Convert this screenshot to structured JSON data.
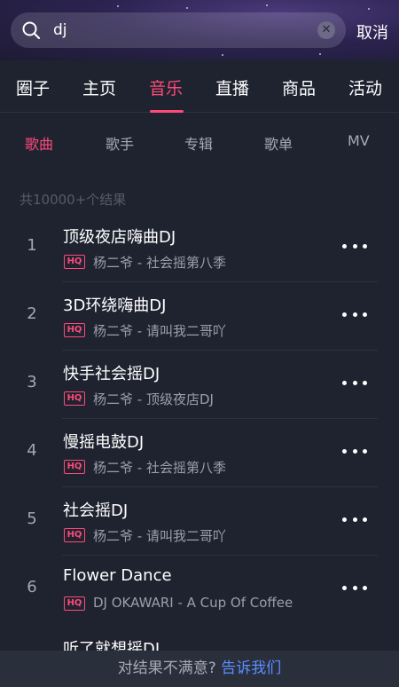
{
  "search": {
    "query": "dj",
    "clear_icon": "close-circle-icon",
    "cancel_label": "取消"
  },
  "tabs": [
    {
      "label": "圈子"
    },
    {
      "label": "主页"
    },
    {
      "label": "音乐",
      "active": true
    },
    {
      "label": "直播"
    },
    {
      "label": "商品"
    },
    {
      "label": "活动"
    }
  ],
  "subtabs": [
    {
      "label": "歌曲",
      "active": true
    },
    {
      "label": "歌手"
    },
    {
      "label": "专辑"
    },
    {
      "label": "歌单"
    },
    {
      "label": "MV"
    }
  ],
  "result_count": "共10000+个结果",
  "songs": [
    {
      "index": "1",
      "title": "顶级夜店嗨曲DJ",
      "badge": "HQ",
      "subtitle": "杨二爷 - 社会摇第八季"
    },
    {
      "index": "2",
      "title": "3D环绕嗨曲DJ",
      "badge": "HQ",
      "subtitle": "杨二爷 - 请叫我二哥吖"
    },
    {
      "index": "3",
      "title": "快手社会摇DJ",
      "badge": "HQ",
      "subtitle": "杨二爷 - 顶级夜店DJ"
    },
    {
      "index": "4",
      "title": "慢摇电鼓DJ",
      "badge": "HQ",
      "subtitle": "杨二爷 - 社会摇第八季"
    },
    {
      "index": "5",
      "title": "社会摇DJ",
      "badge": "HQ",
      "subtitle": "杨二爷 - 请叫我二哥吖"
    },
    {
      "index": "6",
      "title": "Flower Dance",
      "badge": "HQ",
      "subtitle": "DJ OKAWARI - A Cup Of Coffee"
    }
  ],
  "partial_song_title": "听了就想摇DJ",
  "footer": {
    "text": "对结果不满意?",
    "link": "告诉我们"
  },
  "colors": {
    "accent": "#ff4a78",
    "link": "#5b8cff",
    "background": "#1f2330"
  }
}
